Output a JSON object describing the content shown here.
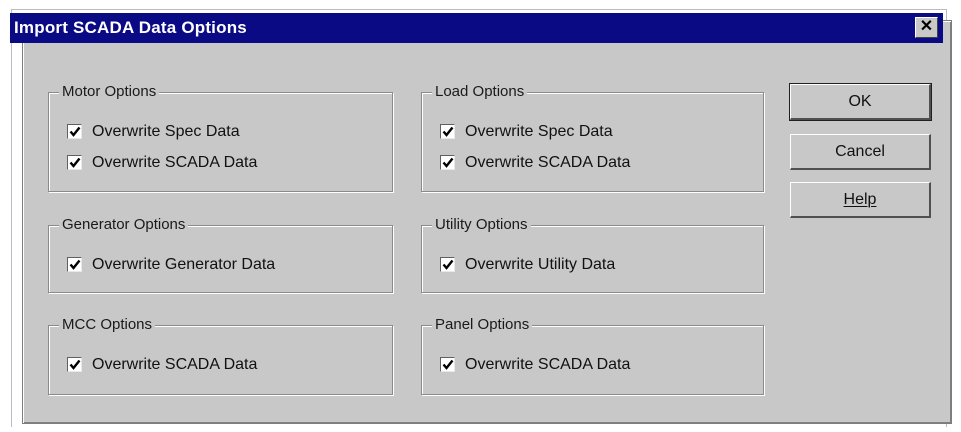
{
  "window": {
    "title": "Import SCADA Data Options",
    "close_glyph": "✕"
  },
  "groups": {
    "motor": {
      "label": "Motor Options",
      "items": [
        {
          "label": "Overwrite Spec Data",
          "checked": true
        },
        {
          "label": "Overwrite SCADA Data",
          "checked": true
        }
      ]
    },
    "load": {
      "label": "Load Options",
      "items": [
        {
          "label": "Overwrite Spec Data",
          "checked": true
        },
        {
          "label": "Overwrite SCADA Data",
          "checked": true
        }
      ]
    },
    "generator": {
      "label": "Generator Options",
      "items": [
        {
          "label": "Overwrite Generator Data",
          "checked": true
        }
      ]
    },
    "utility": {
      "label": "Utility Options",
      "items": [
        {
          "label": "Overwrite Utility Data",
          "checked": true
        }
      ]
    },
    "mcc": {
      "label": "MCC Options",
      "items": [
        {
          "label": "Overwrite SCADA Data",
          "checked": true
        }
      ]
    },
    "panel": {
      "label": "Panel Options",
      "items": [
        {
          "label": "Overwrite SCADA Data",
          "checked": true
        }
      ]
    }
  },
  "buttons": {
    "ok": "OK",
    "cancel": "Cancel",
    "help": "Help"
  },
  "colors": {
    "titlebar": "#0a0a84",
    "dialog_face": "#c8c8c8"
  }
}
